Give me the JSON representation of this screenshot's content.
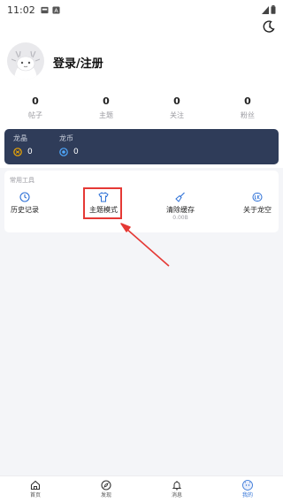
{
  "status_bar": {
    "time": "11:02"
  },
  "profile": {
    "login_label": "登录/注册"
  },
  "stats": [
    {
      "value": "0",
      "label": "帖子"
    },
    {
      "value": "0",
      "label": "主题"
    },
    {
      "value": "0",
      "label": "关注"
    },
    {
      "value": "0",
      "label": "粉丝"
    }
  ],
  "wallet": {
    "items": [
      {
        "label": "龙晶",
        "value": "0",
        "icon": "dragon-crystal-icon"
      },
      {
        "label": "龙币",
        "value": "0",
        "icon": "dragon-coin-icon"
      }
    ]
  },
  "tools": {
    "title": "常用工具",
    "items": [
      {
        "label": "历史记录",
        "icon": "clock-icon",
        "sub": ""
      },
      {
        "label": "主题模式",
        "icon": "tshirt-icon",
        "sub": ""
      },
      {
        "label": "清除缓存",
        "icon": "broom-icon",
        "sub": "0.00B"
      },
      {
        "label": "关于龙空",
        "icon": "about-icon",
        "sub": ""
      }
    ]
  },
  "bottom_nav": {
    "items": [
      {
        "label": "首页",
        "icon": "home-icon"
      },
      {
        "label": "发现",
        "icon": "compass-icon"
      },
      {
        "label": "消息",
        "icon": "bell-icon"
      },
      {
        "label": "我的",
        "icon": "profile-avatar-icon"
      }
    ],
    "active_index": 3
  },
  "colors": {
    "wallet_bg": "#2f3c59",
    "accent": "#2b6fd6",
    "highlight": "#e53935",
    "crystal": "#f2a900"
  }
}
